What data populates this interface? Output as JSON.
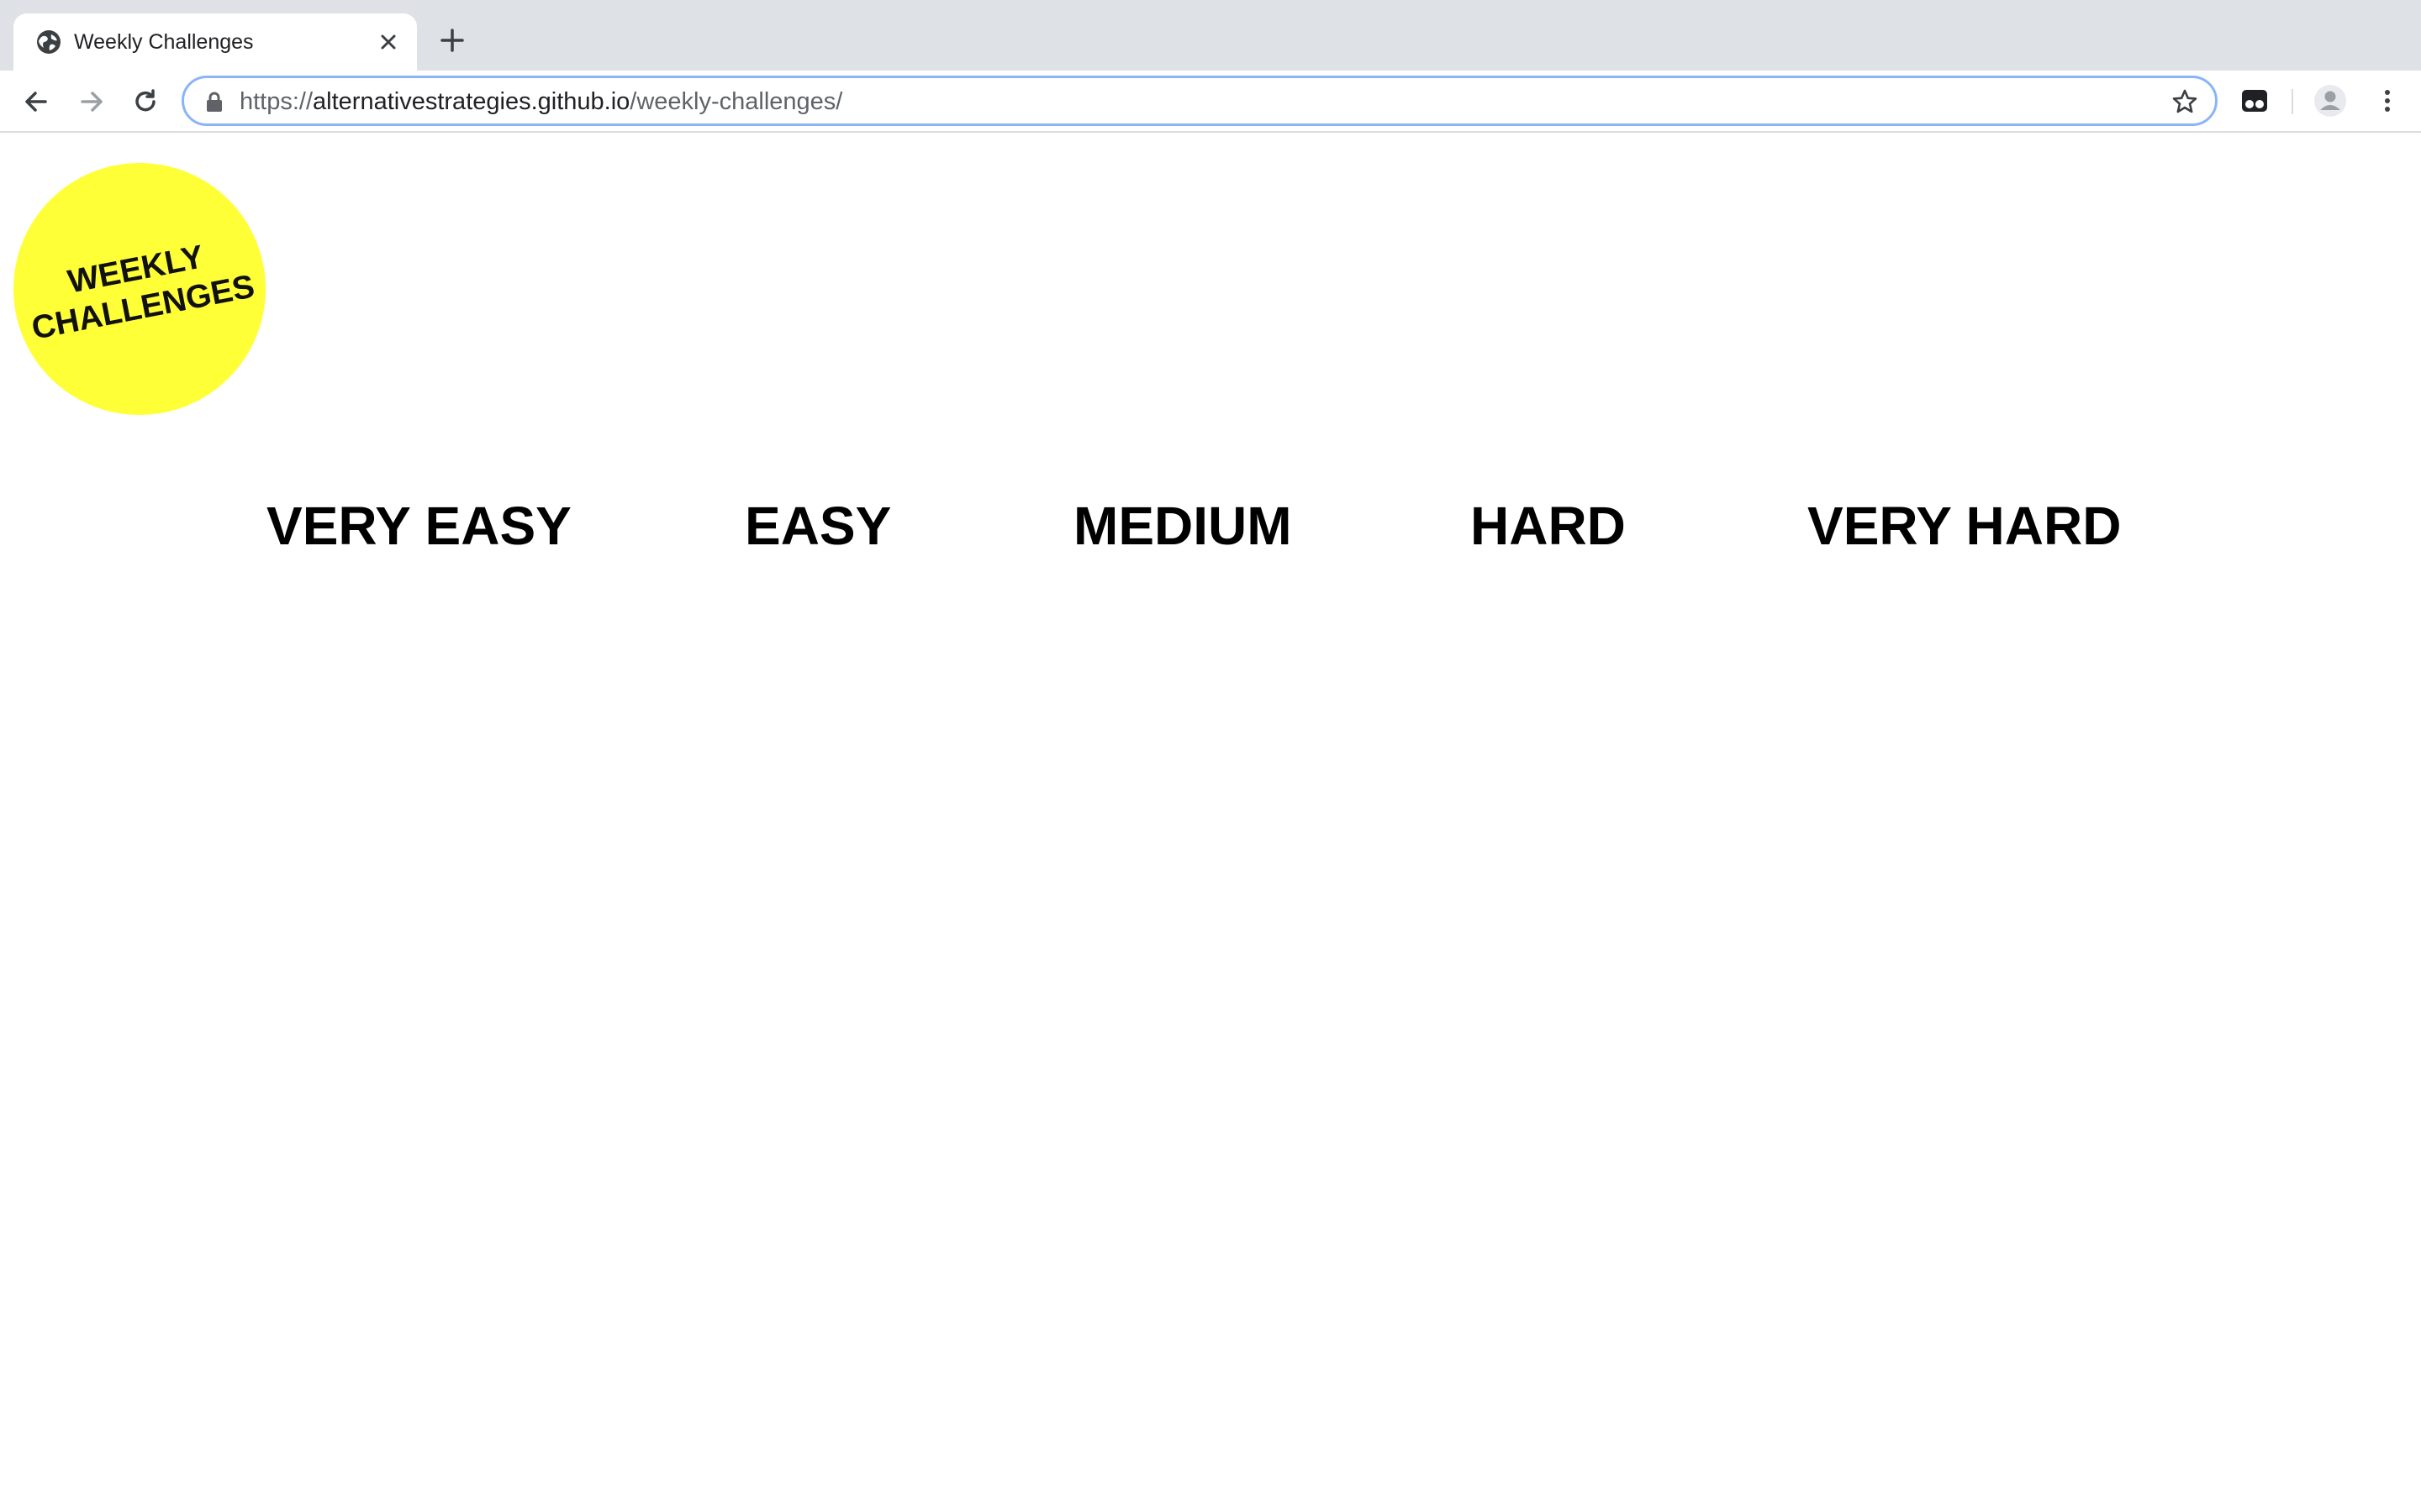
{
  "browser": {
    "tab": {
      "title": "Weekly Challenges",
      "favicon": "globe-icon"
    },
    "url": {
      "scheme": "https://",
      "host": "alternativestrategies.github.io",
      "path": "/weekly-challenges/"
    },
    "icons": {
      "back": "back-arrow-icon",
      "forward": "forward-arrow-icon",
      "reload": "reload-icon",
      "lock": "lock-icon",
      "bookmark": "star-icon",
      "extension": "extension-icon",
      "profile": "profile-icon",
      "menu": "kebab-menu-icon"
    }
  },
  "logo": {
    "line1": "Weekly",
    "line2": "Challenges",
    "color": "#ffff38"
  },
  "levels": [
    {
      "label": "VERY EASY"
    },
    {
      "label": "EASY"
    },
    {
      "label": "MEDIUM"
    },
    {
      "label": "HARD"
    },
    {
      "label": "VERY HARD"
    }
  ]
}
